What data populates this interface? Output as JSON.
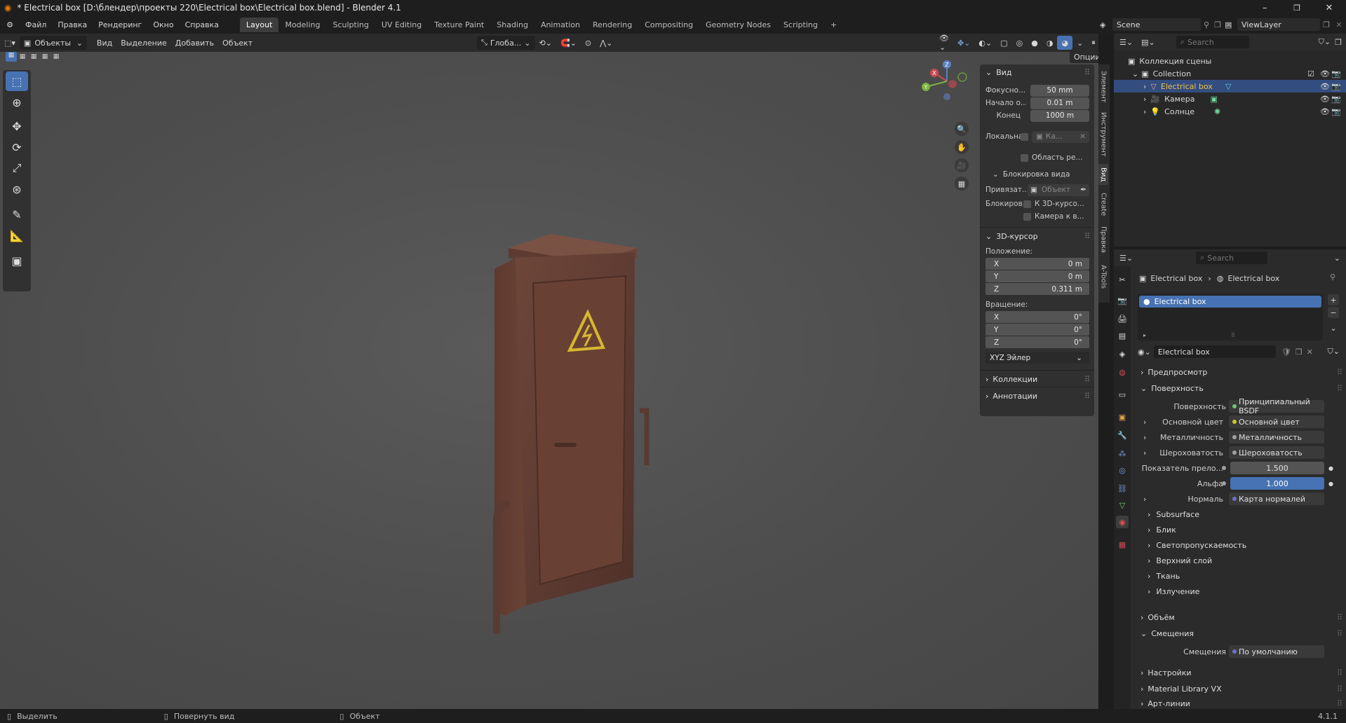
{
  "window": {
    "title": "* Electrical box [D:\\блендер\\проекты 220\\Electrical box\\Electrical box.blend] - Blender 4.1",
    "minimize": "–",
    "maximize": "❐",
    "close": "✕"
  },
  "menu": {
    "items": [
      "Файл",
      "Правка",
      "Рендеринг",
      "Окно",
      "Справка"
    ],
    "workspaces": [
      "Layout",
      "Modeling",
      "Sculpting",
      "UV Editing",
      "Texture Paint",
      "Shading",
      "Animation",
      "Rendering",
      "Compositing",
      "Geometry Nodes",
      "Scripting"
    ],
    "active_workspace": "Layout",
    "add_workspace": "+",
    "scene_label": "Scene",
    "viewlayer_label": "ViewLayer"
  },
  "viewport_header": {
    "mode": "Объекты",
    "menus": [
      "Вид",
      "Выделение",
      "Добавить",
      "Объект"
    ],
    "orientation": "Глоба...",
    "options": "Опции"
  },
  "npanel": {
    "view_header": "Вид",
    "focal_label": "Фокусно...",
    "focal_value": "50 mm",
    "clip_start_label": "Начало о...",
    "clip_start_value": "0.01 m",
    "clip_end_label": "Конец",
    "clip_end_value": "1000 m",
    "local_camera_label": "Локальна...",
    "local_camera_value": "Ка...",
    "render_region_label": "Область ре...",
    "lock_header": "Блокировка вида",
    "lock_object_label": "Привязат...",
    "lock_object_placeholder": "Объект",
    "lock_label": "Блокиров...",
    "lock_cursor": "К 3D-курсо...",
    "lock_camera": "Камера к в...",
    "cursor_header": "3D-курсор",
    "location_label": "Положение:",
    "loc_x_label": "X",
    "loc_x": "0 m",
    "loc_y_label": "Y",
    "loc_y": "0 m",
    "loc_z_label": "Z",
    "loc_z": "0.311 m",
    "rotation_label": "Вращение:",
    "rot_x_label": "X",
    "rot_x": "0°",
    "rot_y_label": "Y",
    "rot_y": "0°",
    "rot_z_label": "Z",
    "rot_z": "0°",
    "rotation_mode": "XYZ Эйлер",
    "collections_header": "Коллекции",
    "annotations_header": "Аннотации",
    "side_tabs": [
      "Элемент",
      "Инструмент",
      "Вид",
      "Create",
      "Правка",
      "A-Tools"
    ]
  },
  "gizmo": {
    "x": "X",
    "y": "Y",
    "z": "Z"
  },
  "outliner": {
    "search_placeholder": "Search",
    "scene_collection": "Коллекция сцены",
    "collection": "Collection",
    "items": [
      {
        "label": "Electrical box",
        "icon": "mesh-icon",
        "selected": true
      },
      {
        "label": "Камера",
        "icon": "camera-icon",
        "selected": false
      },
      {
        "label": "Солнце",
        "icon": "sun-icon",
        "selected": false
      }
    ]
  },
  "properties": {
    "search_placeholder": "Search",
    "breadcrumb_object": "Electrical box",
    "breadcrumb_material": "Electrical box",
    "slot_name": "Electrical box",
    "material_name": "Electrical box",
    "preview": "Предпросмотр",
    "surface_header": "Поверхность",
    "surface_label": "Поверхность",
    "surface_value": "Принципиальный BSDF",
    "rows": [
      {
        "label": "Основной цвет",
        "value": "Основной цвет",
        "color": "#c7c729"
      },
      {
        "label": "Металличность",
        "value": "Металличность",
        "color": "#a0a0a0"
      },
      {
        "label": "Шероховатость",
        "value": "Шероховатость",
        "color": "#a0a0a0"
      }
    ],
    "ior_label": "Показатель прело...",
    "ior_value": "1.500",
    "alpha_label": "Альфа",
    "alpha_value": "1.000",
    "normal_label": "Нормаль",
    "normal_value": "Карта нормалей",
    "subsections": [
      "Subsurface",
      "Блик",
      "Светопропускаемость",
      "Верхний слой",
      "Ткань",
      "Излучение"
    ],
    "volume": "Объём",
    "displacement_header": "Смещения",
    "displacement_label": "Смещения",
    "displacement_value": "По умолчанию",
    "settings": "Настройки",
    "material_library": "Material Library VX",
    "line_art": "Арт-линии"
  },
  "statusbar": {
    "select": "Выделить",
    "rotate": "Повернуть вид",
    "object": "Объект",
    "version": "4.1.1"
  },
  "colors": {
    "accent": "#4772b3",
    "selection": "#334d80",
    "box_body": "#5e3a30"
  }
}
